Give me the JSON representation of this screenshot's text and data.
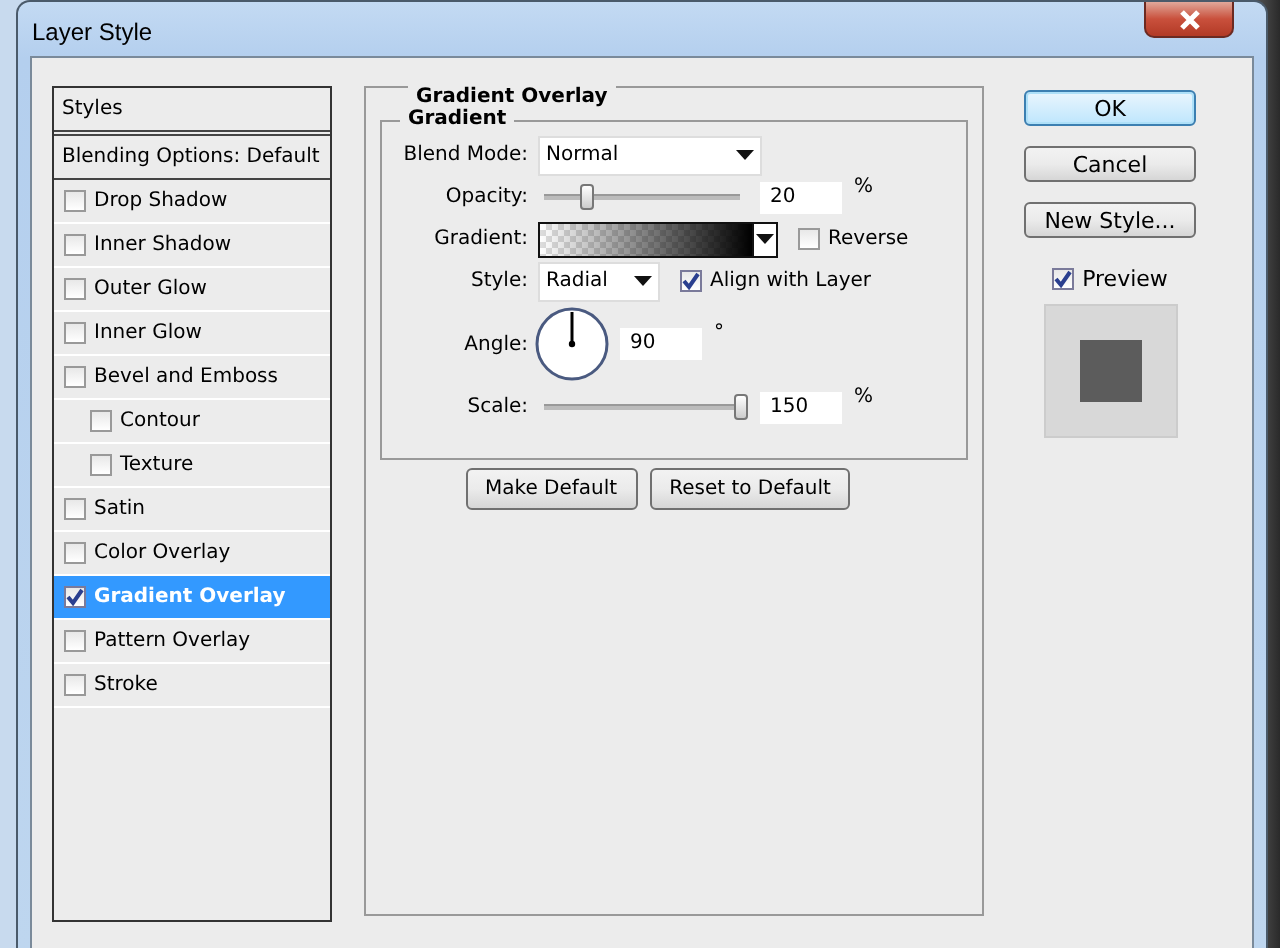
{
  "window": {
    "title": "Layer Style"
  },
  "styles_panel": {
    "header": "Styles",
    "blending_options": "Blending Options: Default",
    "items": [
      {
        "label": "Drop Shadow",
        "checked": false,
        "selected": false
      },
      {
        "label": "Inner Shadow",
        "checked": false,
        "selected": false
      },
      {
        "label": "Outer Glow",
        "checked": false,
        "selected": false
      },
      {
        "label": "Inner Glow",
        "checked": false,
        "selected": false
      },
      {
        "label": "Bevel and Emboss",
        "checked": false,
        "selected": false,
        "children": [
          {
            "label": "Contour",
            "checked": false,
            "selected": false
          },
          {
            "label": "Texture",
            "checked": false,
            "selected": false
          }
        ]
      },
      {
        "label": "Satin",
        "checked": false,
        "selected": false
      },
      {
        "label": "Color Overlay",
        "checked": false,
        "selected": false
      },
      {
        "label": "Gradient Overlay",
        "checked": true,
        "selected": true
      },
      {
        "label": "Pattern Overlay",
        "checked": false,
        "selected": false
      },
      {
        "label": "Stroke",
        "checked": false,
        "selected": false
      }
    ]
  },
  "gradient_overlay": {
    "title": "Gradient Overlay",
    "group_title": "Gradient",
    "blend_mode": {
      "label": "Blend Mode:",
      "value": "Normal"
    },
    "opacity": {
      "label": "Opacity:",
      "level": 0.2,
      "value": "20",
      "unit": "%"
    },
    "gradient": {
      "label": "Gradient:",
      "reverse": {
        "label": "Reverse",
        "checked": false
      }
    },
    "style": {
      "label": "Style:",
      "value": "Radial",
      "align_with_layer": {
        "label": "Align with Layer",
        "checked": true
      }
    },
    "angle": {
      "label": "Angle:",
      "value": "90",
      "unit": "°"
    },
    "scale": {
      "label": "Scale:",
      "level": 1,
      "value": "150",
      "unit": "%"
    },
    "buttons": [
      "Make Default",
      "Reset to Default"
    ]
  },
  "actions": [
    {
      "label": "OK",
      "kind": "default"
    },
    {
      "label": "Cancel",
      "kind": "normal"
    },
    {
      "label": "New Style...",
      "kind": "normal"
    }
  ],
  "preview": {
    "label": "Preview",
    "checked": true
  }
}
